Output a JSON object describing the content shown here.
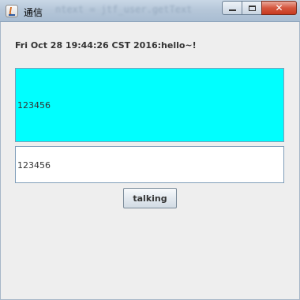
{
  "window": {
    "title": "通信",
    "background_code_hint": "ntext = jtf_user.getText"
  },
  "header": {
    "message": "Fri Oct 28 19:44:26 CST 2016:hello~!"
  },
  "chat_area": {
    "text": "123456",
    "background_color": "#00ffff"
  },
  "input": {
    "value": "123456"
  },
  "actions": {
    "talk_label": "talking"
  }
}
